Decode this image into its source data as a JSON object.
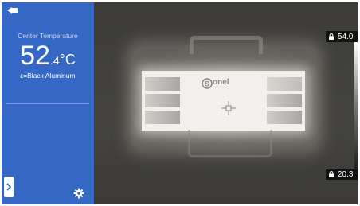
{
  "sidebar": {
    "center_label": "Center Temperature",
    "temp_integer": "52",
    "temp_decimal": ".4",
    "temp_unit": "°C",
    "emissivity": "ε=Black Aluminum",
    "battery_icon": "battery-charging-icon",
    "expand_icon": "chevron-right-icon",
    "settings_icon": "gear-icon"
  },
  "thermal_view": {
    "logo_text": "onel",
    "scale": {
      "max": "54.0",
      "min": "20.3",
      "lock_icon": "lock-icon"
    }
  },
  "colors": {
    "sidebar_bg": "#3567c4",
    "scene_bg": "#3f3f3c",
    "hot": "#f1f0ec"
  }
}
